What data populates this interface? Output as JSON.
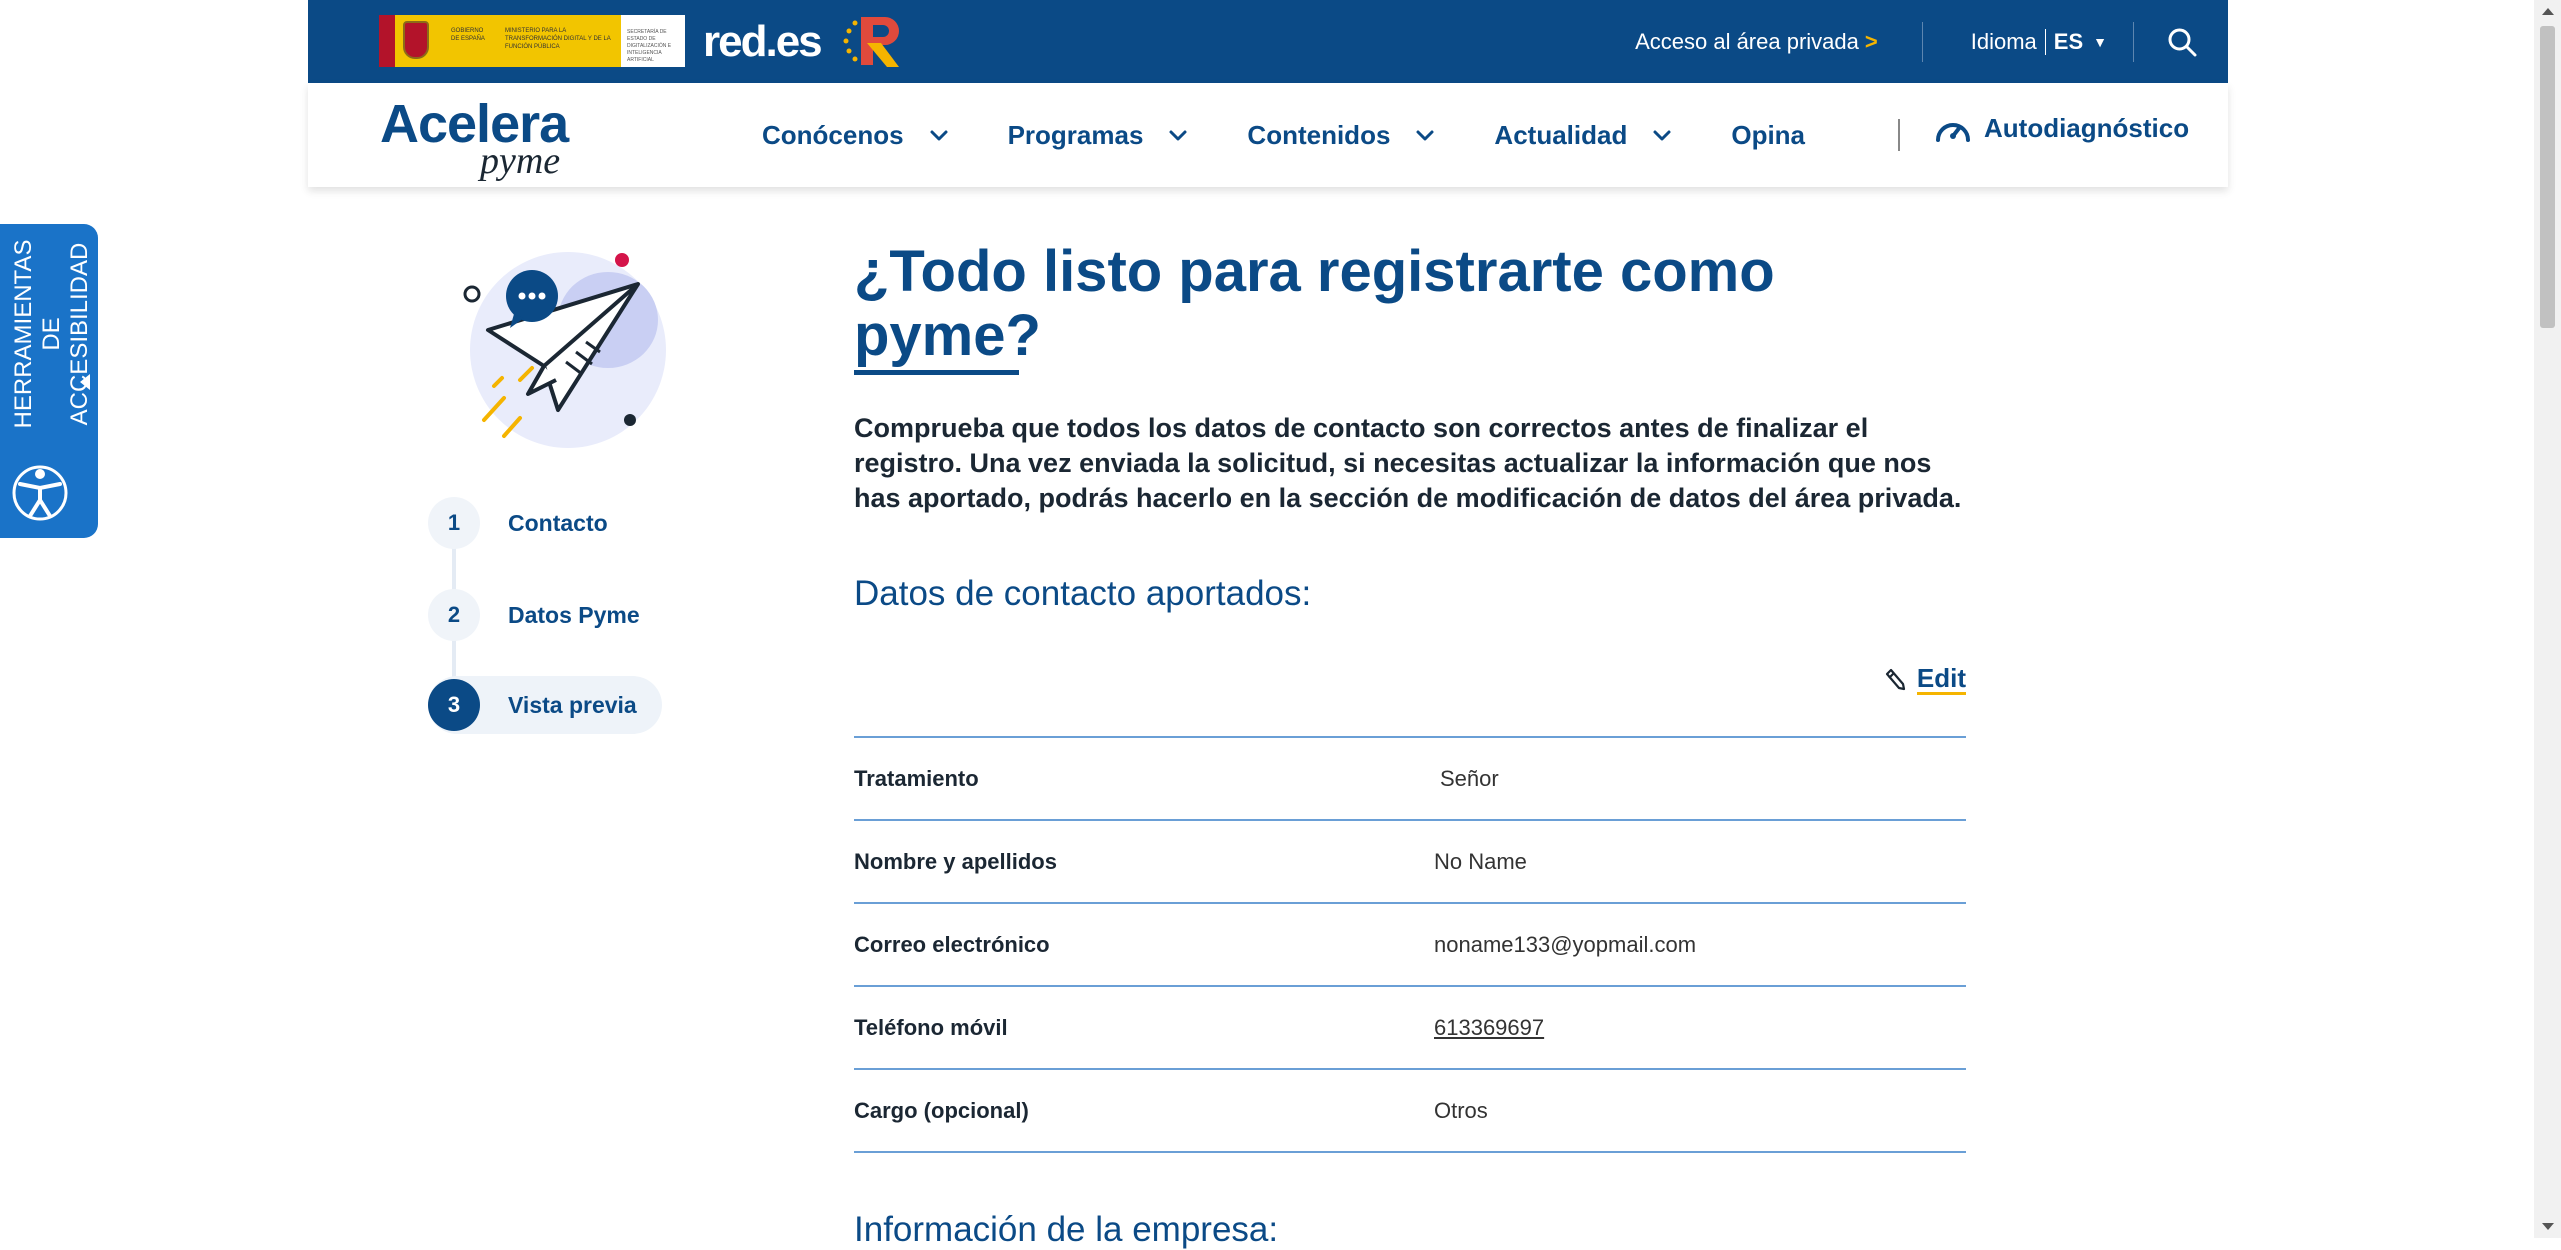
{
  "topbar": {
    "gov_text_1": "GOBIERNO DE ESPAÑA",
    "gov_text_2": "MINISTERIO PARA LA TRANSFORMACIÓN DIGITAL Y DE LA FUNCIÓN PÚBLICA",
    "gov_text_3": "SECRETARÍA DE ESTADO DE DIGITALIZACIÓN E INTELIGENCIA ARTIFICIAL",
    "redes_logo": "red.es",
    "private_area": "Acceso al área privada",
    "private_arrow": ">",
    "language_label": "Idioma",
    "language_code": "ES"
  },
  "nav": {
    "brand_main": "Acelera",
    "brand_sub": "pyme",
    "items": [
      {
        "label": "Conócenos"
      },
      {
        "label": "Programas"
      },
      {
        "label": "Contenidos"
      },
      {
        "label": "Actualidad"
      },
      {
        "label": "Opina"
      }
    ],
    "autodiagnostico": "Autodiagnóstico"
  },
  "accessibility": {
    "label": "HERRAMIENTAS DE ACCESIBILIDAD"
  },
  "steps": [
    {
      "number": "1",
      "label": "Contacto"
    },
    {
      "number": "2",
      "label": "Datos Pyme"
    },
    {
      "number": "3",
      "label": "Vista previa"
    }
  ],
  "main": {
    "title": "¿Todo listo para registrarte como pyme?",
    "intro": "Comprueba que todos los datos de contacto son correctos antes de finalizar el registro. Una vez enviada la solicitud, si necesitas actualizar la información que nos has aportado, podrás hacerlo en la sección de modificación de datos del área privada.",
    "contact_heading": "Datos de contacto aportados:",
    "edit_label": "Edit",
    "rows": [
      {
        "key": "Tratamiento",
        "value": "Señor"
      },
      {
        "key": "Nombre y apellidos",
        "value": "No Name"
      },
      {
        "key": "Correo electrónico",
        "value": "noname133@yopmail.com"
      },
      {
        "key": "Teléfono móvil",
        "value": "613369697"
      },
      {
        "key": "Cargo (opcional)",
        "value": "Otros"
      }
    ],
    "company_heading": "Información de la empresa:"
  },
  "colors": {
    "primary": "#0b4a86",
    "accent": "#f5b400",
    "accessibility_tab": "#1a73c8",
    "row_border": "#6a9fd6"
  }
}
